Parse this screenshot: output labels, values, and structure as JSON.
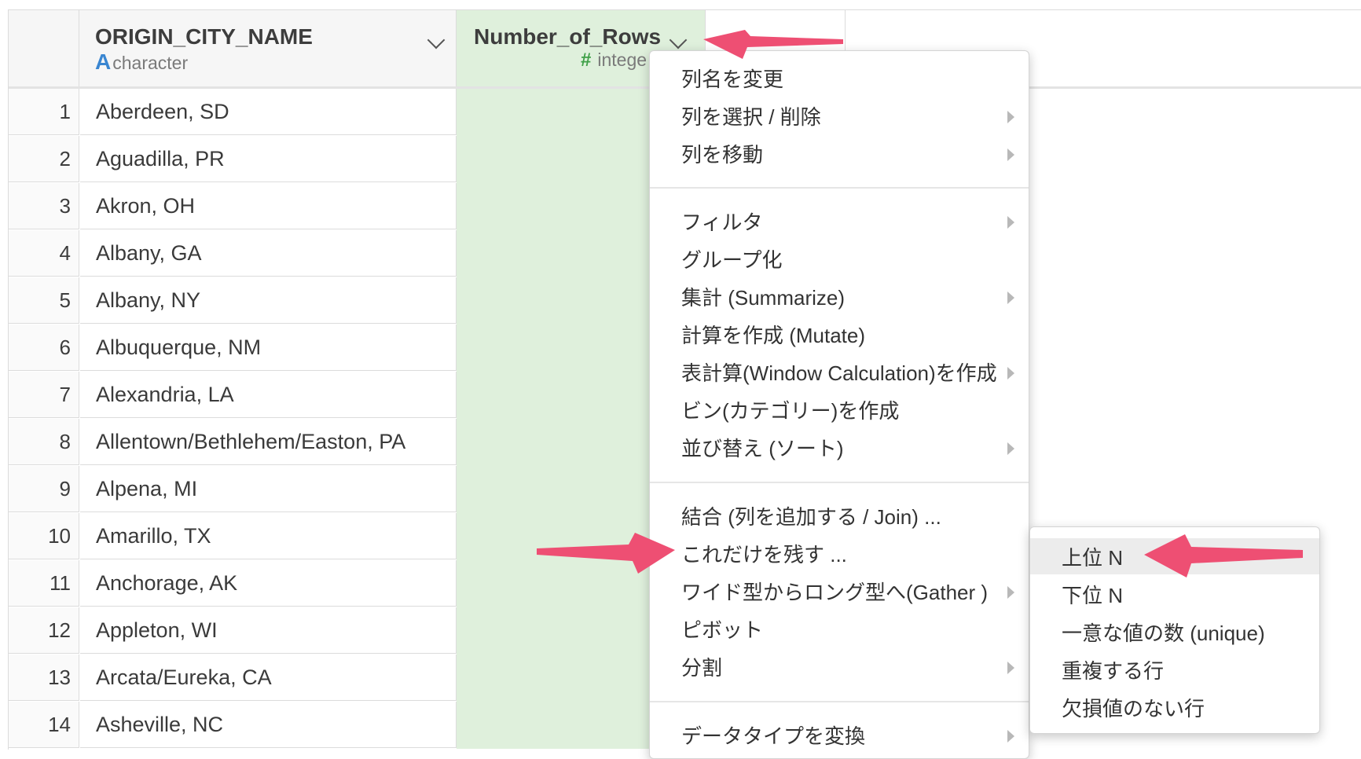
{
  "columns": [
    {
      "name": "ORIGIN_CITY_NAME",
      "type_icon": "A",
      "type": "character"
    },
    {
      "name": "Number_of_Rows",
      "type_icon": "#",
      "type": "integer",
      "type_visible": "intege"
    }
  ],
  "rows": [
    {
      "num": "1",
      "city": "Aberdeen, SD"
    },
    {
      "num": "2",
      "city": "Aguadilla, PR"
    },
    {
      "num": "3",
      "city": "Akron, OH"
    },
    {
      "num": "4",
      "city": "Albany, GA"
    },
    {
      "num": "5",
      "city": "Albany, NY"
    },
    {
      "num": "6",
      "city": "Albuquerque, NM"
    },
    {
      "num": "7",
      "city": "Alexandria, LA"
    },
    {
      "num": "8",
      "city": "Allentown/Bethlehem/Easton, PA"
    },
    {
      "num": "9",
      "city": "Alpena, MI"
    },
    {
      "num": "10",
      "city": "Amarillo, TX"
    },
    {
      "num": "11",
      "city": "Anchorage, AK"
    },
    {
      "num": "12",
      "city": "Appleton, WI"
    },
    {
      "num": "13",
      "city": "Arcata/Eureka, CA"
    },
    {
      "num": "14",
      "city": "Asheville, NC"
    }
  ],
  "menu": {
    "items": [
      {
        "label": "列名を変更",
        "has_submenu": false
      },
      {
        "label": "列を選択 / 削除",
        "has_submenu": true
      },
      {
        "label": "列を移動",
        "has_submenu": true
      },
      {
        "label": "フィルタ",
        "has_submenu": true
      },
      {
        "label": "グループ化",
        "has_submenu": false
      },
      {
        "label": "集計 (Summarize)",
        "has_submenu": true
      },
      {
        "label": "計算を作成 (Mutate)",
        "has_submenu": false
      },
      {
        "label": "表計算(Window Calculation)を作成",
        "has_submenu": true
      },
      {
        "label": "ビン(カテゴリー)を作成",
        "has_submenu": false
      },
      {
        "label": "並び替え (ソート)",
        "has_submenu": true
      },
      {
        "label": "結合 (列を追加する / Join) ...",
        "has_submenu": false
      },
      {
        "label": "これだけを残す ...",
        "has_submenu": false
      },
      {
        "label": "ワイド型からロング型へ(Gather )",
        "has_submenu": true
      },
      {
        "label": "ピボット",
        "has_submenu": false
      },
      {
        "label": "分割",
        "has_submenu": true
      },
      {
        "label": "データタイプを変換",
        "has_submenu": true
      }
    ]
  },
  "submenu": {
    "items": [
      {
        "label": "上位 N",
        "highlighted": true
      },
      {
        "label": "下位 N",
        "highlighted": false
      },
      {
        "label": "一意な値の数 (unique)",
        "highlighted": false
      },
      {
        "label": "重複する行",
        "highlighted": false
      },
      {
        "label": "欠損値のない行",
        "highlighted": false
      }
    ]
  },
  "colors": {
    "selected_column_bg": "#dff0dc",
    "annotation_arrow": "#ee4f73",
    "type_character": "#3a86d1",
    "type_integer": "#3fa048"
  }
}
